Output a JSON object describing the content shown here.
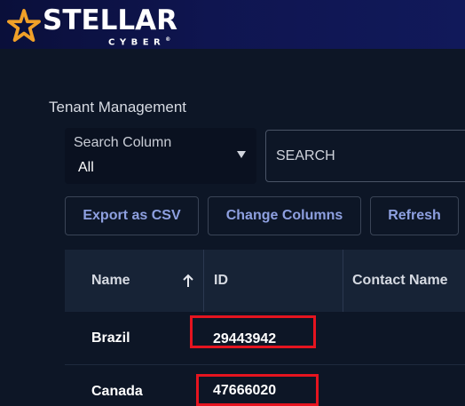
{
  "brand": {
    "name": "STELLAR",
    "subname": "CYBER",
    "trademark": "®"
  },
  "page": {
    "title": "Tenant Management"
  },
  "search": {
    "column_label": "Search Column",
    "column_value": "All",
    "placeholder": "SEARCH"
  },
  "toolbar": {
    "export_label": "Export as CSV",
    "columns_label": "Change Columns",
    "refresh_label": "Refresh"
  },
  "table": {
    "columns": [
      "Name",
      "ID",
      "Contact Name"
    ],
    "sorted_column": "Name",
    "sort_direction": "ascending",
    "rows": [
      {
        "name": "Brazil",
        "id": "29443942"
      },
      {
        "name": "Canada",
        "id": "47666020"
      }
    ]
  },
  "colors": {
    "background": "#0d1626",
    "header_bar": "#0f1550",
    "accent_button_text": "#8ea0e0",
    "logo_star": "#f0a028",
    "highlight": "#e5141f"
  },
  "icons": {
    "logo": "stellar-star-icon",
    "dropdown": "caret-down-icon",
    "sort": "arrow-up-icon"
  }
}
